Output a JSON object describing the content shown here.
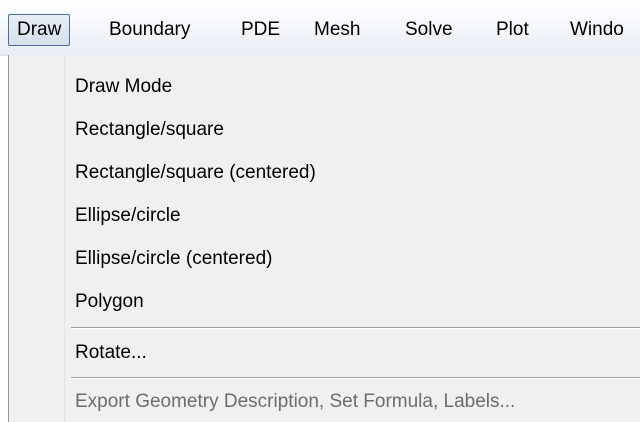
{
  "menubar": {
    "items": [
      {
        "label": "Draw"
      },
      {
        "label": "Boundary"
      },
      {
        "label": "PDE"
      },
      {
        "label": "Mesh"
      },
      {
        "label": "Solve"
      },
      {
        "label": "Plot"
      },
      {
        "label": "Windo"
      }
    ]
  },
  "draw_menu": {
    "items": [
      {
        "label": "Draw Mode",
        "enabled": true
      },
      {
        "label": "Rectangle/square",
        "enabled": true
      },
      {
        "label": "Rectangle/square (centered)",
        "enabled": true
      },
      {
        "label": "Ellipse/circle",
        "enabled": true
      },
      {
        "label": "Ellipse/circle (centered)",
        "enabled": true
      },
      {
        "label": "Polygon",
        "enabled": true
      },
      {
        "label": "Rotate...",
        "enabled": true
      },
      {
        "label": "Export Geometry Description, Set Formula, Labels...",
        "enabled": false
      }
    ]
  }
}
